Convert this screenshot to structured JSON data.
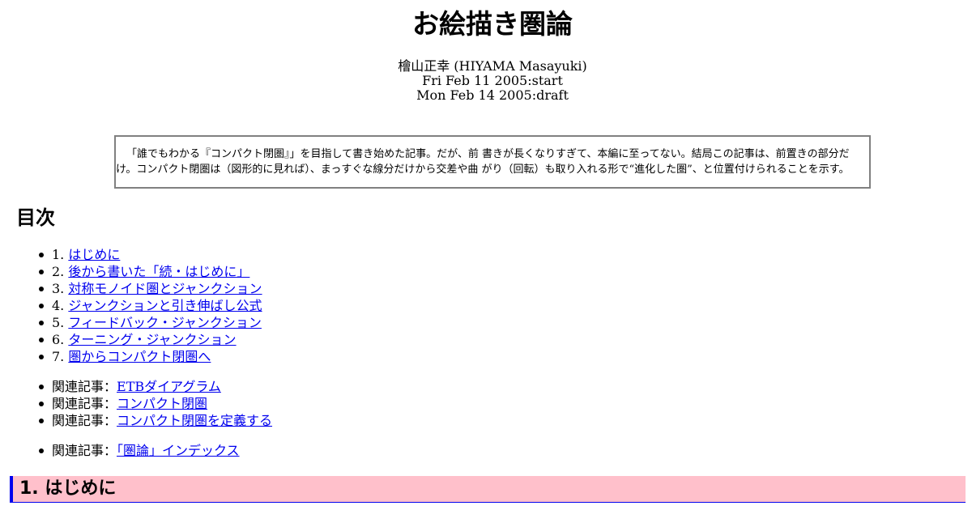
{
  "title": "お絵描き圏論",
  "author": "檜山正幸 (HIYAMA Masayuki)",
  "dates": [
    "Fri Feb 11 2005:start",
    "Mon Feb 14 2005:draft"
  ],
  "abstract": "「誰でもわかる『コンパクト閉圏』」を目指して書き始めた記事。だが、前 書きが長くなりすぎて、本編に至ってない。結局この記事は、前置きの部分だけ。コンパクト閉圏は（図形的に見れば）、まっすぐな線分だけから交差や曲 がり（回転）も取り入れる形で“進化した圏”、と位置付けられることを示す。",
  "toc": {
    "heading": "目次",
    "items": [
      {
        "num": "1.",
        "label": "はじめに"
      },
      {
        "num": "2.",
        "label": "後から書いた「続・はじめに」"
      },
      {
        "num": "3.",
        "label": "対称モノイド圏とジャンクション"
      },
      {
        "num": "4.",
        "label": "ジャンクションと引き伸ばし公式"
      },
      {
        "num": "5.",
        "label": "フィードバック・ジャンクション"
      },
      {
        "num": "6.",
        "label": "ターニング・ジャンクション"
      },
      {
        "num": "7.",
        "label": "圏からコンパクト閉圏へ"
      }
    ]
  },
  "related": {
    "prefix": "関連記事：",
    "items": [
      {
        "label": "ETBダイアグラム"
      },
      {
        "label": "コンパクト閉圏"
      },
      {
        "label": "コンパクト閉圏を定義する"
      }
    ]
  },
  "index_link": {
    "prefix": "関連記事：",
    "label": "「圏論」インデックス"
  },
  "section1": {
    "heading": "1. はじめに"
  },
  "colors": {
    "link": "#0000ee",
    "section_bg": "#ffc0cb",
    "section_border": "#0000ee",
    "box_border": "#808080"
  }
}
